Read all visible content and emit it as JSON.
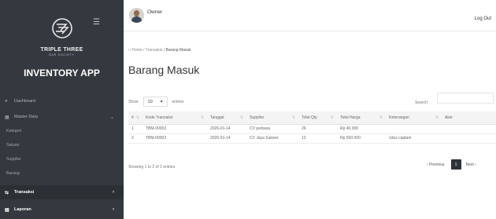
{
  "sidebar": {
    "brand": "TRIPLE THREE",
    "brand_sub": "BAR SOCIETY",
    "app_name": "INVENTORY APP",
    "items": [
      {
        "label": "Dashboard",
        "icon": "dashboard-icon"
      },
      {
        "label": "Master Data",
        "icon": "database-icon"
      },
      {
        "label": "Kategori"
      },
      {
        "label": "Satuan"
      },
      {
        "label": "Supplier"
      },
      {
        "label": "Barang"
      },
      {
        "label": "Transaksi",
        "icon": "transfer-icon"
      },
      {
        "label": "Laporan",
        "icon": "report-icon"
      }
    ]
  },
  "topbar": {
    "user": "Owner",
    "logout": "Log Out"
  },
  "breadcrumb": {
    "home": "Home",
    "sep": "/",
    "transaksi": "Transaksi",
    "current": "Barang Masuk"
  },
  "page_title": "Barang Masuk",
  "table_controls": {
    "show_label": "Show",
    "entries_value": "10",
    "entries_label": "entries",
    "search_label": "Search:"
  },
  "table": {
    "headers": [
      "#",
      "Kode Transaksi",
      "Tanggal",
      "Supplier",
      "Total Qty",
      "Total Harga",
      "Keterangan",
      "Aksi"
    ],
    "rows": [
      [
        "1",
        "TBM-00003",
        "2026-01-14",
        "CV perkasa",
        "26",
        "Rp 40.000",
        "",
        ""
      ],
      [
        "2",
        "TBM-00002",
        "2026-01-14",
        "CV Jaya Sukses",
        "12",
        "Rp 550.000",
        "1dus captain",
        ""
      ]
    ]
  },
  "footer": {
    "info": "Showing 1 to 2 of 2 entries",
    "previous": "Previous",
    "page": "1",
    "next": "Next"
  }
}
